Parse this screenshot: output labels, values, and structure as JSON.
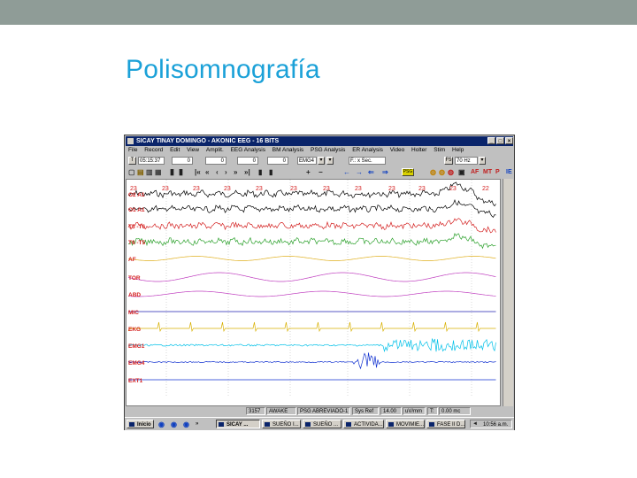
{
  "slide": {
    "title": "Polisomnografía"
  },
  "window": {
    "title": "SICAY TINAY DOMINGO - AKONIC EEG - 16 BITS",
    "controls": [
      "_",
      "□",
      "×"
    ],
    "menu": [
      "File",
      "Record",
      "Edit",
      "View",
      "Amplit.",
      "EEG Analysis",
      "BM Analysis",
      "PSG Analysis",
      "ER Analysis",
      "Video",
      "Holter",
      "Stim",
      "Help"
    ]
  },
  "toolbar": {
    "t_label": "T",
    "time": "05:15:37",
    "field1": "0",
    "field2": "0",
    "field3": "0",
    "field4": "0",
    "montage": "EMG4",
    "filter": "F.: x Sec.",
    "f5_label": "F5",
    "freq": "70 Hz",
    "psg_label": "PSG",
    "af_label": "AF",
    "mt_label": "MT",
    "p_label": "P",
    "ie_label": "IE"
  },
  "channels": [
    "O2 A1",
    "O1 A1",
    "T5 -T6",
    "T6 -T5",
    "AF",
    "TOR",
    "ABD",
    "MIC",
    "EKG",
    "EMG1",
    "EMG4",
    "EXT1"
  ],
  "channel_colors": [
    "#000000",
    "#000000",
    "#d42020",
    "#2aa02a",
    "#e0b020",
    "#c040c0",
    "#c040c0",
    "#2020b0",
    "#d8b000",
    "#00c0e8",
    "#1030d0",
    "#1030d0"
  ],
  "markers": [
    "23",
    "23",
    "23",
    "23",
    "23",
    "23",
    "23",
    "23",
    "23",
    "23",
    "23",
    "22"
  ],
  "status": {
    "epoch": "3157",
    "stage": "AWAKE",
    "study": "PSG ABREVIADO-1",
    "sync": "Sys Ref",
    "gain": "14.00",
    "gain_unit": "uV/mm",
    "t_label": "T:",
    "t_value": "0.00 mc"
  },
  "taskbar": {
    "start": "Inicio",
    "tasks": [
      "SICAY ...",
      "SUEÑO I...",
      "SUEÑO ...",
      "ACTIVIDA...",
      "MOVIMIE...",
      "FASE II D..."
    ],
    "clock": "10:56 a.m."
  }
}
